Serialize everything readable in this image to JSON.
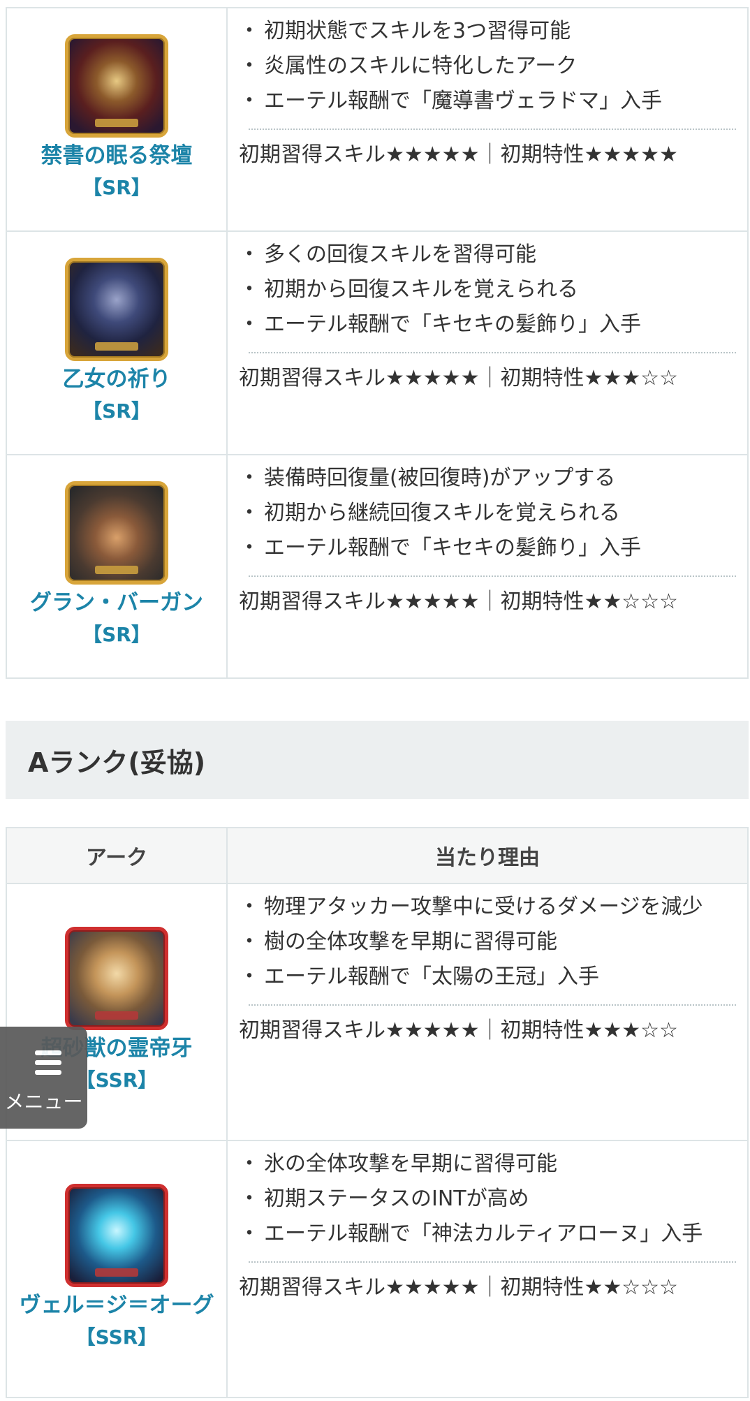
{
  "sections": {
    "upper_rows": [
      {
        "name": "禁書の眠る祭壇",
        "rank": "【SR】",
        "reasons": [
          "初期状態でスキルを3つ習得可能",
          "炎属性のスキルに特化したアーク",
          "エーテル報酬で「魔導書ヴェラドマ」入手"
        ],
        "rating": "初期習得スキル★★★★★｜初期特性★★★★★"
      },
      {
        "name": "乙女の祈り",
        "rank": "【SR】",
        "reasons": [
          "多くの回復スキルを習得可能",
          "初期から回復スキルを覚えられる",
          "エーテル報酬で「キセキの髪飾り」入手"
        ],
        "rating": "初期習得スキル★★★★★｜初期特性★★★☆☆"
      },
      {
        "name": "グラン・バーガン",
        "rank": "【SR】",
        "reasons": [
          "装備時回復量(被回復時)がアップする",
          "初期から継続回復スキルを覚えられる",
          "エーテル報酬で「キセキの髪飾り」入手"
        ],
        "rating": "初期習得スキル★★★★★｜初期特性★★☆☆☆"
      }
    ],
    "a_rank": {
      "heading": "Aランク(妥協)",
      "col_ark": "アーク",
      "col_reason": "当たり理由",
      "rows": [
        {
          "name": "超砂獣の霊帝牙",
          "rank": "【SSR】",
          "reasons": [
            "物理アタッカー攻撃中に受けるダメージを減少",
            "樹の全体攻撃を早期に習得可能",
            "エーテル報酬で「太陽の王冠」入手"
          ],
          "rating": "初期習得スキル★★★★★｜初期特性★★★☆☆"
        },
        {
          "name": "ヴェル＝ジ＝オーグ",
          "rank": "【SSR】",
          "reasons": [
            "氷の全体攻撃を早期に習得可能",
            "初期ステータスのINTが高め",
            "エーテル報酬で「神法カルティアローヌ」入手"
          ],
          "rating": "初期習得スキル★★★★★｜初期特性★★☆☆☆"
        }
      ]
    }
  },
  "menu": {
    "label": "メニュー",
    "icon": "list-menu-icon"
  },
  "colors": {
    "link": "#1c84a8",
    "border": "#dde4e6",
    "heading_bg": "#eceff0",
    "gold_frame": "#d8a53a",
    "red_frame": "#cf2f2f"
  }
}
